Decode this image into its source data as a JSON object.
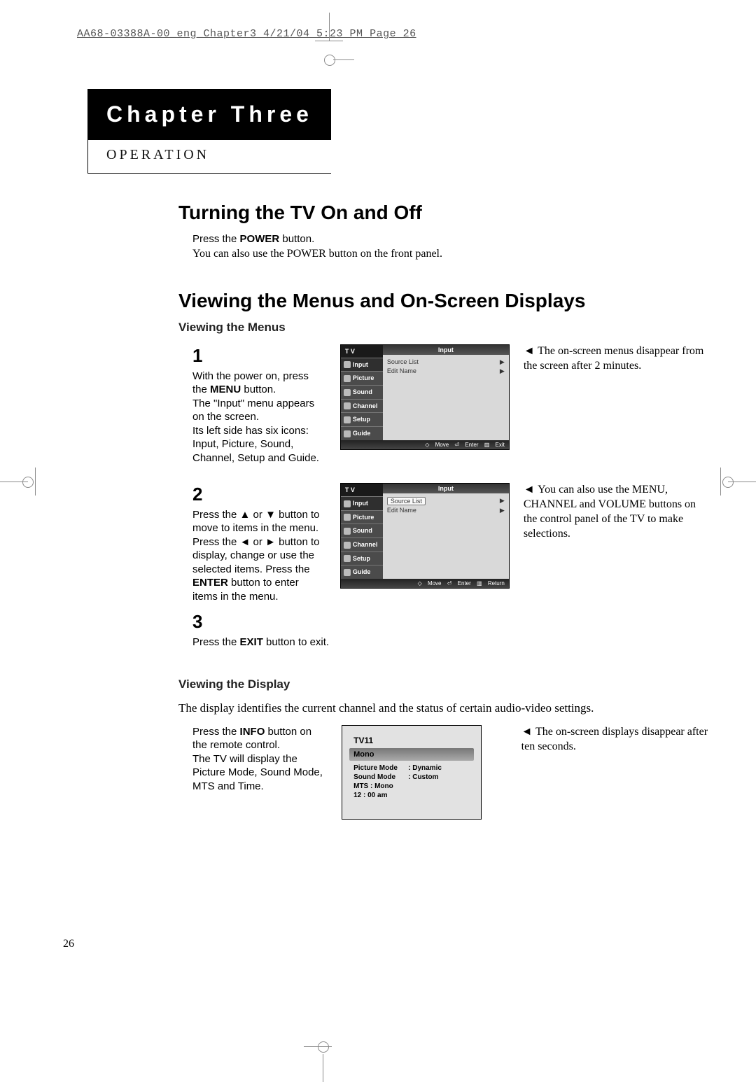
{
  "header_line": "AA68-03388A-00_eng_Chapter3  4/21/04  5:23 PM  Page 26",
  "chapter_label": "Chapter Three",
  "chapter_sub": "OPERATION",
  "section1_title": "Turning the TV On and Off",
  "section1_line1_pre": "Press the ",
  "section1_line1_bold": "POWER",
  "section1_line1_post": " button.",
  "section1_note": "You can also use the POWER button on the front panel.",
  "section2_title": "Viewing the Menus and On-Screen Displays",
  "section2_sub1": "Viewing the Menus",
  "step1_num": "1",
  "step1_text_a": "With the power on, press the ",
  "step1_text_bold": "MENU",
  "step1_text_b": " button.",
  "step1_text_c": "The \"Input\" menu appears on the screen.",
  "step1_text_d": "Its left side has six icons: Input, Picture, Sound, Channel, Setup and Guide.",
  "step1_side": "The on-screen menus disappear from the screen after 2 minutes.",
  "step2_num": "2",
  "step2_text_a": "Press the ",
  "step2_sym_up": "▲",
  "step2_or1": " or ",
  "step2_sym_down": "▼",
  "step2_text_b": " button to move to items in the menu.",
  "step2_text_c": "Press the ",
  "step2_sym_left": "◄",
  "step2_or2": " or ",
  "step2_sym_right": "►",
  "step2_text_d": " button to display, change or use the selected items. Press the ",
  "step2_bold": "ENTER",
  "step2_text_e": " button to enter items in the menu.",
  "step2_side": "You can also use the MENU, CHANNEL  and VOLUME buttons on the control panel of the TV to make selections.",
  "step3_num": "3",
  "step3_text_a": "Press the ",
  "step3_bold": "EXIT",
  "step3_text_b": " button to exit.",
  "section2_sub2": "Viewing the Display",
  "display_intro": "The display identifies the current channel and the status of certain audio-video settings.",
  "disp_left_a": "Press the ",
  "disp_left_bold": "INFO",
  "disp_left_b": " button on the remote control.",
  "disp_left_c": "The TV will display the Picture Mode, Sound Mode, MTS and Time.",
  "disp_side": "The on-screen displays disappear after ten seconds.",
  "tv_menu": {
    "title_left": "T V",
    "panel_title": "Input",
    "tabs": [
      "Input",
      "Picture",
      "Sound",
      "Channel",
      "Setup",
      "Guide"
    ],
    "items": [
      "Source List",
      "Edit Name"
    ],
    "footer_move": "Move",
    "footer_enter": "Enter",
    "footer_exit": "Exit",
    "footer_return": "Return"
  },
  "info": {
    "channel": "TV11",
    "audio": "Mono",
    "picture_mode_k": "Picture Mode",
    "picture_mode_v": ": Dynamic",
    "sound_mode_k": "Sound Mode",
    "sound_mode_v": ": Custom",
    "mts_line": "MTS : Mono",
    "time": "12 : 00 am"
  },
  "page_number": "26"
}
